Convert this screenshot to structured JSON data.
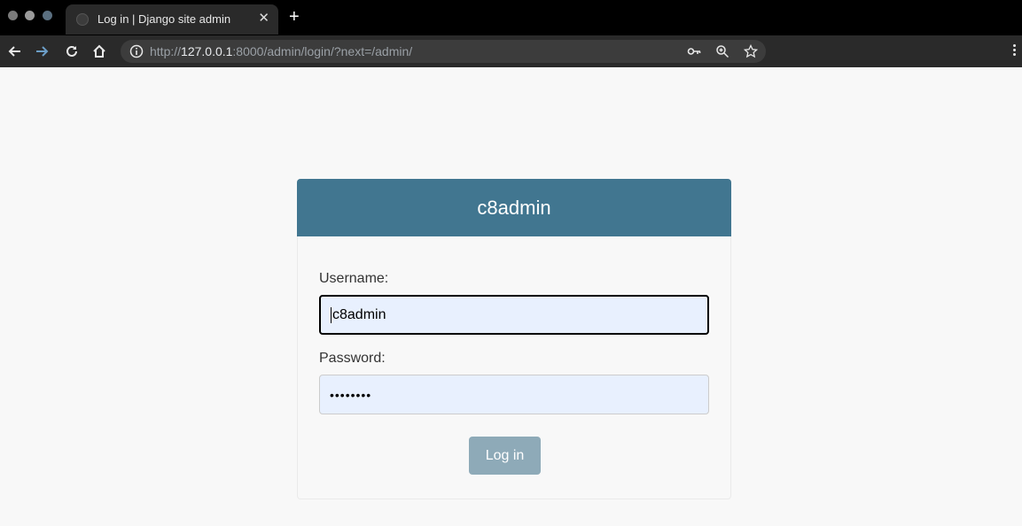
{
  "browser": {
    "tab_title": "Log in | Django site admin",
    "tab_close": "✕",
    "new_tab": "+",
    "url_prefix": "http://",
    "url_host": "127.0.0.1",
    "url_rest": ":8000/admin/login/?next=/admin/"
  },
  "login": {
    "site_name": "c8admin",
    "username_label": "Username:",
    "username_value": "c8admin",
    "password_label": "Password:",
    "password_value": "••••••••",
    "submit_label": "Log in"
  },
  "colors": {
    "header": "#417690",
    "button": "#8eaab8",
    "input_bg": "#e8f0fe"
  }
}
